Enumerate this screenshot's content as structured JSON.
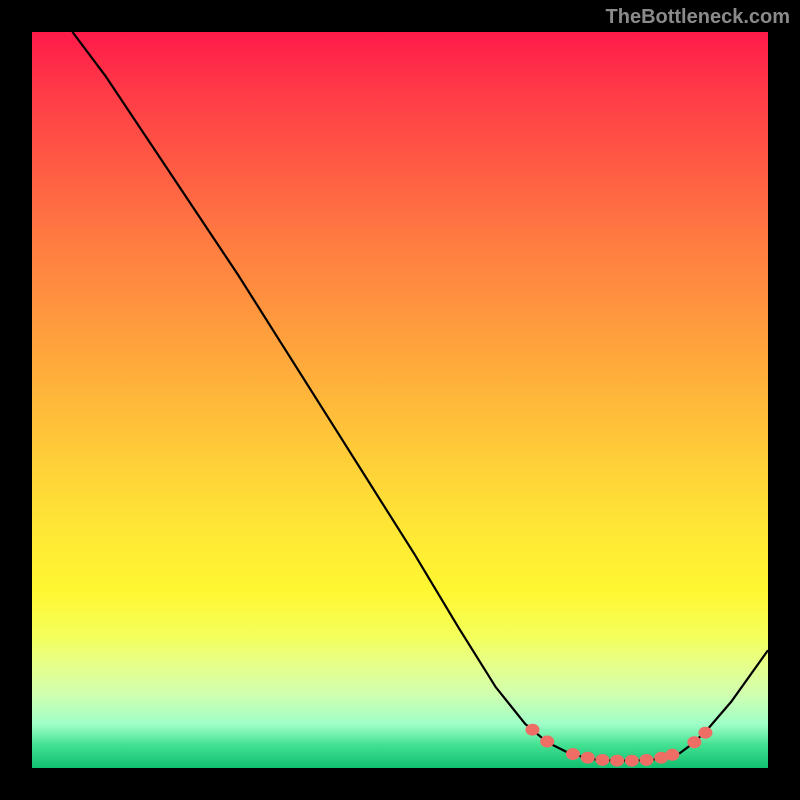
{
  "watermark": "TheBottleneck.com",
  "chart_data": {
    "type": "line",
    "title": "",
    "xlabel": "",
    "ylabel": "",
    "xlim": [
      0,
      100
    ],
    "ylim": [
      0,
      100
    ],
    "curve": [
      {
        "x": 5.5,
        "y": 100
      },
      {
        "x": 10,
        "y": 94
      },
      {
        "x": 16,
        "y": 85
      },
      {
        "x": 22,
        "y": 76
      },
      {
        "x": 28,
        "y": 67
      },
      {
        "x": 34,
        "y": 57.5
      },
      {
        "x": 40,
        "y": 48
      },
      {
        "x": 46,
        "y": 38.5
      },
      {
        "x": 52,
        "y": 29
      },
      {
        "x": 58,
        "y": 19
      },
      {
        "x": 63,
        "y": 11
      },
      {
        "x": 67,
        "y": 6
      },
      {
        "x": 70,
        "y": 3.5
      },
      {
        "x": 73,
        "y": 2
      },
      {
        "x": 76,
        "y": 1.2
      },
      {
        "x": 79,
        "y": 1
      },
      {
        "x": 82,
        "y": 1
      },
      {
        "x": 85,
        "y": 1.2
      },
      {
        "x": 88,
        "y": 2
      },
      {
        "x": 90,
        "y": 3.5
      },
      {
        "x": 92,
        "y": 5.5
      },
      {
        "x": 95,
        "y": 9
      },
      {
        "x": 100,
        "y": 16
      }
    ],
    "highlight_points": [
      {
        "x": 68,
        "y": 5.2
      },
      {
        "x": 70,
        "y": 3.6
      },
      {
        "x": 73.5,
        "y": 1.9
      },
      {
        "x": 75.5,
        "y": 1.4
      },
      {
        "x": 77.5,
        "y": 1.1
      },
      {
        "x": 79.5,
        "y": 1.0
      },
      {
        "x": 81.5,
        "y": 1.0
      },
      {
        "x": 83.5,
        "y": 1.1
      },
      {
        "x": 85.5,
        "y": 1.4
      },
      {
        "x": 87,
        "y": 1.8
      },
      {
        "x": 90,
        "y": 3.5
      },
      {
        "x": 91.5,
        "y": 4.8
      }
    ],
    "highlight_color": "#ee6e66",
    "highlight_radius": 7
  }
}
